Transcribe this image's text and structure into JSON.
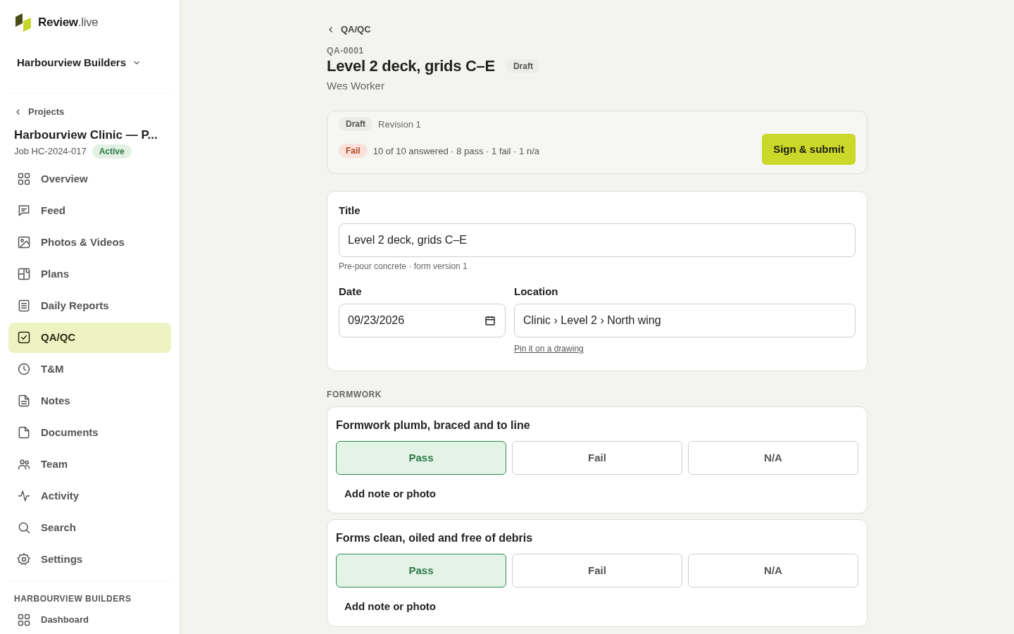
{
  "brand": {
    "name": "Review",
    "suffix": ".live"
  },
  "org_switcher": {
    "label": "Harbourview Builders"
  },
  "back_link": {
    "label": "Projects"
  },
  "project": {
    "name": "Harbourview Clinic — P...",
    "job": "Job HC-2024-017",
    "status": "Active"
  },
  "nav": [
    {
      "label": "Overview",
      "selected": false
    },
    {
      "label": "Feed",
      "selected": false
    },
    {
      "label": "Photos & Videos",
      "selected": false
    },
    {
      "label": "Plans",
      "selected": false
    },
    {
      "label": "Daily Reports",
      "selected": false
    },
    {
      "label": "QA/QC",
      "selected": true
    },
    {
      "label": "T&M",
      "selected": false
    },
    {
      "label": "Notes",
      "selected": false
    },
    {
      "label": "Documents",
      "selected": false
    },
    {
      "label": "Team",
      "selected": false
    },
    {
      "label": "Activity",
      "selected": false
    },
    {
      "label": "Search",
      "selected": false
    },
    {
      "label": "Settings",
      "selected": false
    }
  ],
  "org_section": {
    "heading": "HARBOURVIEW BUILDERS",
    "items": [
      {
        "label": "Dashboard",
        "selected": false
      }
    ]
  },
  "breadcrumb": "QA/QC",
  "record": {
    "code": "QA-0001",
    "title": "Level 2 deck, grids C–E",
    "status": "Draft",
    "author": "Wes Worker"
  },
  "summary": {
    "status": "Draft",
    "revision": "Revision 1",
    "result": "Fail",
    "counts": "10 of 10 answered · 8 pass · 1 fail · 1 n/a",
    "submit": "Sign & submit"
  },
  "form": {
    "title_label": "Title",
    "title_value": "Level 2 deck, grids C–E",
    "hint": "Pre-pour concrete · form version 1",
    "date_label": "Date",
    "date_value": "09/23/2026",
    "location_label": "Location",
    "location_value": "Clinic › Level 2 › North wing",
    "pin_link": "Pin it on a drawing"
  },
  "sections": [
    {
      "heading": "FORMWORK",
      "items": [
        {
          "question": "Formwork plumb, braced and to line",
          "options": [
            {
              "label": "Pass",
              "selected": true
            },
            {
              "label": "Fail",
              "selected": false
            },
            {
              "label": "N/A",
              "selected": false
            }
          ],
          "note": "Add note or photo"
        },
        {
          "question": "Forms clean, oiled and free of debris",
          "options": [
            {
              "label": "Pass",
              "selected": true
            },
            {
              "label": "Fail",
              "selected": false
            },
            {
              "label": "N/A",
              "selected": false
            }
          ],
          "note": "Add note or photo"
        }
      ]
    }
  ]
}
